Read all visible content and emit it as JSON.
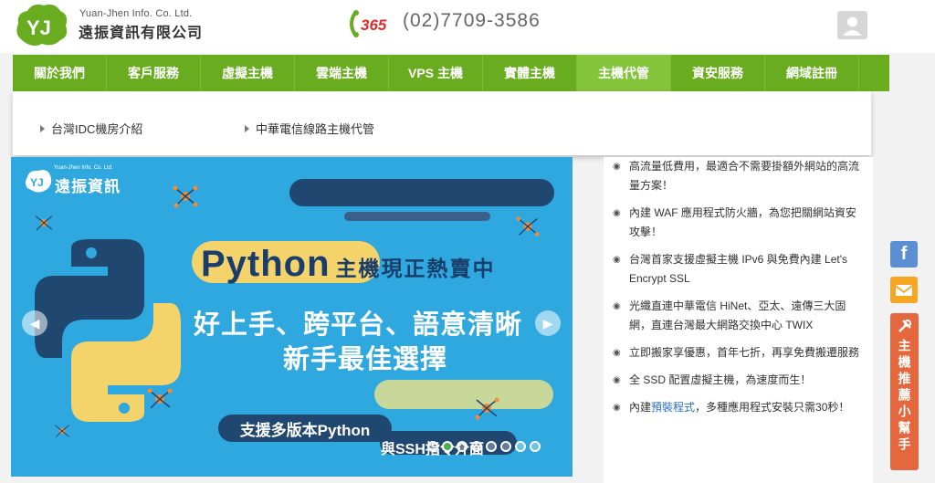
{
  "header": {
    "company_en": "Yuan-Jhen Info. Co. Ltd.",
    "company_zh": "遠振資訊有限公司",
    "phone_badge": "365",
    "phone": "(02)7709-3586"
  },
  "nav": {
    "items": [
      "關於我們",
      "客戶服務",
      "虛擬主機",
      "雲端主機",
      "VPS 主機",
      "實體主機",
      "主機代管",
      "資安服務",
      "網域註冊"
    ],
    "active_index": 6
  },
  "dropdown": {
    "items": [
      "台灣IDC機房介紹",
      "中華電信線路主機代管"
    ]
  },
  "banner": {
    "logo_en": "Yuan-Jhen Info. Co. Ltd.",
    "logo_zh": "遠振資訊",
    "heading_python": "Python",
    "heading_zh": "主機現正熱賣中",
    "sub1": "好上手、跨平台、語意清晰",
    "sub2": "新手最佳選擇",
    "tag1": "支援多版本Python",
    "tag2": "與SSH指令介面",
    "slide_count": 8,
    "active_slide": 1,
    "colors": {
      "bg": "#2ea8df",
      "navy": "#1a3e6c",
      "yellow": "#f4d36b",
      "green": "#c9d89a"
    }
  },
  "features": [
    {
      "text": "高流量低費用，最適合不需要掛額外網站的高流量方案！"
    },
    {
      "text": "內建 WAF 應用程式防火牆，為您把關網站資安攻擊！"
    },
    {
      "text": "台灣首家支援虛擬主機 IPv6 與免費內建 Let's Encrypt SSL"
    },
    {
      "text": "光纖直連中華電信 HiNet、亞太、遠傳三大固網，直連台灣最大網路交換中心 TWIX"
    },
    {
      "text": "立即搬家享優惠，首年七折，再享免費搬遷服務"
    },
    {
      "text": "全 SSD 配置虛擬主機，為速度而生！"
    },
    {
      "prefix": "內建",
      "link": "預裝程式",
      "suffix": "，多種應用程式安裝只需30秒！"
    }
  ],
  "social": {
    "facebook_glyph": "f",
    "helper_label": "主機推薦小幫手"
  },
  "colors": {
    "nav_green": "#69ac1f",
    "nav_active": "#83c43a",
    "helper_orange": "#e4673d",
    "fb_blue": "#5b8fd4",
    "mail_orange": "#f5a623"
  }
}
